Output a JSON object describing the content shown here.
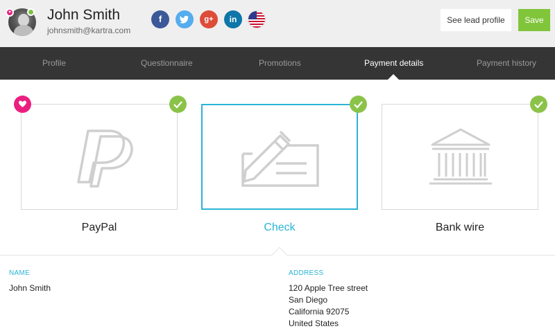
{
  "header": {
    "name": "John Smith",
    "email": "johnsmith@kartra.com",
    "see_lead_profile": "See lead profile",
    "save": "Save",
    "social": {
      "facebook": "f",
      "twitter": "twitter-icon",
      "googleplus": "g+",
      "linkedin": "in",
      "flag": "us-flag-icon"
    }
  },
  "nav": {
    "tabs": [
      {
        "label": "Profile",
        "active": false
      },
      {
        "label": "Questionnaire",
        "active": false
      },
      {
        "label": "Promotions",
        "active": false
      },
      {
        "label": "Payment details",
        "active": true
      },
      {
        "label": "Payment history",
        "active": false
      }
    ]
  },
  "payment_methods": [
    {
      "label": "PayPal",
      "icon": "paypal-icon",
      "verified": true,
      "favorite": true,
      "selected": false
    },
    {
      "label": "Check",
      "icon": "check-icon",
      "verified": true,
      "favorite": false,
      "selected": true
    },
    {
      "label": "Bank wire",
      "icon": "bank-icon",
      "verified": true,
      "favorite": false,
      "selected": false
    }
  ],
  "details": {
    "name_label": "NAME",
    "name_value": "John Smith",
    "address_label": "ADDRESS",
    "address_lines": [
      "120 Apple Tree street",
      "San Diego",
      "California 92075",
      "United States"
    ]
  },
  "colors": {
    "accent": "#2ab4d6",
    "save_green": "#80c53a",
    "check_green": "#8bc34a",
    "favorite_pink": "#ea1f7f",
    "nav_bg": "#353535"
  }
}
